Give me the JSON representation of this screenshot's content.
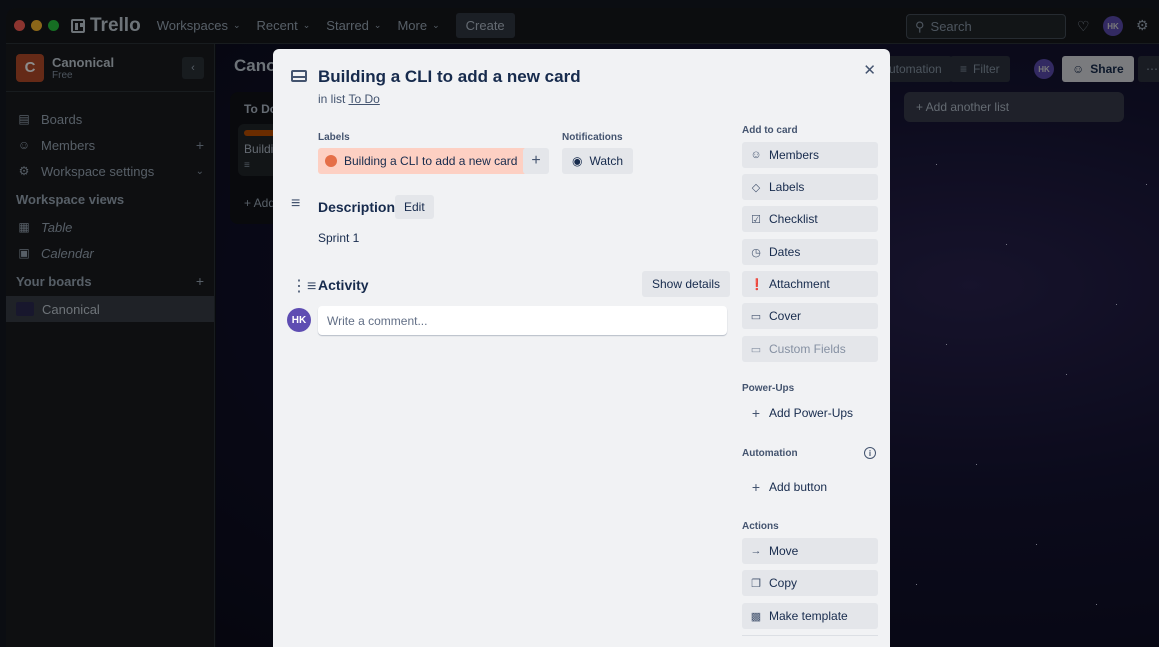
{
  "topbar": {
    "app_name": "Trello",
    "nav": [
      {
        "label": "Workspaces"
      },
      {
        "label": "Recent"
      },
      {
        "label": "Starred"
      },
      {
        "label": "More"
      }
    ],
    "create_label": "Create",
    "search_placeholder": "Search",
    "avatar_initials": "HK"
  },
  "sidebar": {
    "workspace_initial": "C",
    "workspace_name": "Canonical",
    "workspace_plan": "Free",
    "items": [
      {
        "label": "Boards"
      },
      {
        "label": "Members"
      },
      {
        "label": "Workspace settings"
      }
    ],
    "views_heading": "Workspace views",
    "views": [
      {
        "label": "Table"
      },
      {
        "label": "Calendar"
      }
    ],
    "boards_heading": "Your boards",
    "boards": [
      {
        "label": "Canonical"
      }
    ]
  },
  "board": {
    "title": "Canonical",
    "list_title": "To Do",
    "card_text": "Building a CLI to add a new card",
    "add_card": "+ Add a card",
    "automation_label": "Automation",
    "filter_label": "Filter",
    "share_label": "Share",
    "add_list_label": "+ Add another list"
  },
  "modal": {
    "title": "Building a CLI to add a new card",
    "in_list_prefix": "in list",
    "list_name": "To Do",
    "labels_heading": "Labels",
    "label_text": "Building a CLI to add a new card",
    "notifications_heading": "Notifications",
    "watch_label": "Watch",
    "description_heading": "Description",
    "edit_label": "Edit",
    "description_text": "Sprint 1",
    "activity_heading": "Activity",
    "show_details_label": "Show details",
    "commenter_initials": "HK",
    "comment_placeholder": "Write a comment...",
    "add_to_card_heading": "Add to card",
    "add_to_card": [
      {
        "label": "Members",
        "icon": "person-icon"
      },
      {
        "label": "Labels",
        "icon": "tag-icon"
      },
      {
        "label": "Checklist",
        "icon": "checklist-icon"
      },
      {
        "label": "Dates",
        "icon": "clock-icon"
      },
      {
        "label": "Attachment",
        "icon": "paperclip-icon"
      },
      {
        "label": "Cover",
        "icon": "cover-icon"
      },
      {
        "label": "Custom Fields",
        "icon": "custom-fields-icon"
      }
    ],
    "powerups_heading": "Power-Ups",
    "add_powerups_label": "Add Power-Ups",
    "automation_heading": "Automation",
    "add_button_label": "Add button",
    "actions_heading": "Actions",
    "actions": [
      {
        "label": "Move",
        "icon": "arrow-right-icon"
      },
      {
        "label": "Copy",
        "icon": "copy-icon"
      },
      {
        "label": "Make template",
        "icon": "template-icon"
      }
    ]
  },
  "colors": {
    "label_red": "#e56f48",
    "label_bg": "#fdd0c3",
    "avatar": "#5e4db2",
    "workspace_badge": "#b94e2a"
  }
}
